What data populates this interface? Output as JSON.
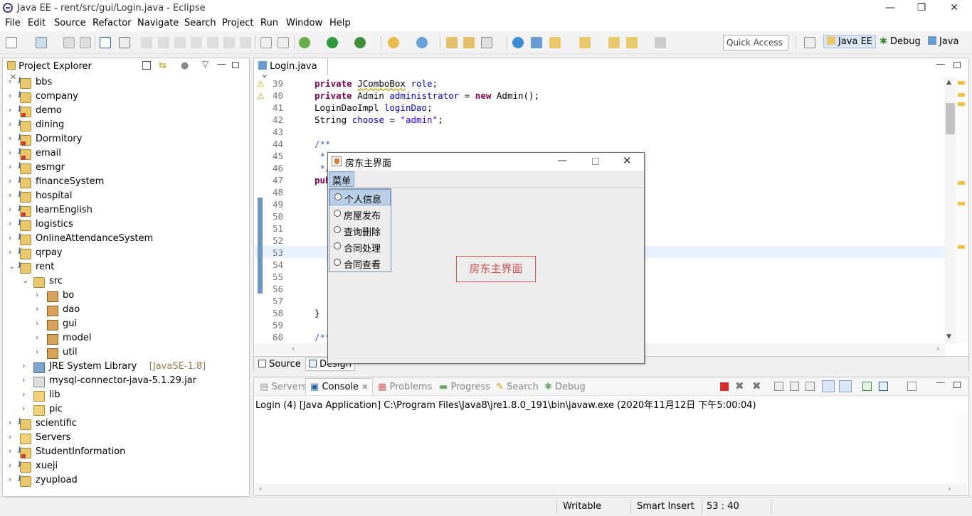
{
  "window": {
    "title": "Java EE - rent/src/gui/Login.java - Eclipse",
    "minimize": "—",
    "maximize": "❐",
    "close": "✕"
  },
  "menu": [
    "File",
    "Edit",
    "Source",
    "Refactor",
    "Navigate",
    "Search",
    "Project",
    "Run",
    "Window",
    "Help"
  ],
  "toolbar": {
    "quick_access_placeholder": "Quick Access"
  },
  "perspectives": [
    "Java EE",
    "Debug",
    "Java"
  ],
  "project_explorer": {
    "title": "Project Explorer",
    "items": [
      {
        "label": "bbs",
        "level": 0,
        "expanded": false,
        "icon": "project-icon"
      },
      {
        "label": "company",
        "level": 0,
        "expanded": false,
        "icon": "project-icon"
      },
      {
        "label": "demo",
        "level": 0,
        "expanded": false,
        "icon": "project-error-icon"
      },
      {
        "label": "dining",
        "level": 0,
        "expanded": false,
        "icon": "project-icon"
      },
      {
        "label": "Dormitory",
        "level": 0,
        "expanded": false,
        "icon": "project-error-icon"
      },
      {
        "label": "email",
        "level": 0,
        "expanded": false,
        "icon": "project-error-icon"
      },
      {
        "label": "esmgr",
        "level": 0,
        "expanded": false,
        "icon": "project-icon"
      },
      {
        "label": "financeSystem",
        "level": 0,
        "expanded": false,
        "icon": "project-icon"
      },
      {
        "label": "hospital",
        "level": 0,
        "expanded": false,
        "icon": "project-icon"
      },
      {
        "label": "learnEnglish",
        "level": 0,
        "expanded": false,
        "icon": "project-error-icon"
      },
      {
        "label": "logistics",
        "level": 0,
        "expanded": false,
        "icon": "project-icon"
      },
      {
        "label": "OnlineAttendanceSystem",
        "level": 0,
        "expanded": false,
        "icon": "project-icon"
      },
      {
        "label": "qrpay",
        "level": 0,
        "expanded": false,
        "icon": "project-icon"
      },
      {
        "label": "rent",
        "level": 0,
        "expanded": true,
        "icon": "project-icon"
      },
      {
        "label": "src",
        "level": 1,
        "expanded": true,
        "icon": "source-folder-icon"
      },
      {
        "label": "bo",
        "level": 2,
        "expanded": false,
        "icon": "package-icon"
      },
      {
        "label": "dao",
        "level": 2,
        "expanded": false,
        "icon": "package-icon"
      },
      {
        "label": "gui",
        "level": 2,
        "expanded": false,
        "icon": "package-icon"
      },
      {
        "label": "model",
        "level": 2,
        "expanded": false,
        "icon": "package-icon"
      },
      {
        "label": "util",
        "level": 2,
        "expanded": false,
        "icon": "package-icon"
      },
      {
        "label": "JRE System Library",
        "suffix": "[JavaSE-1.8]",
        "level": 1,
        "expanded": false,
        "icon": "library-icon"
      },
      {
        "label": "mysql-connector-java-5.1.29.jar",
        "level": 1,
        "expanded": false,
        "icon": "jar-icon"
      },
      {
        "label": "lib",
        "level": 1,
        "expanded": false,
        "icon": "folder-icon"
      },
      {
        "label": "pic",
        "level": 1,
        "expanded": false,
        "icon": "folder-icon"
      },
      {
        "label": "scientific",
        "level": 0,
        "expanded": false,
        "icon": "project-icon"
      },
      {
        "label": "Servers",
        "level": 0,
        "expanded": false,
        "icon": "folder-icon"
      },
      {
        "label": "StudentInformation",
        "level": 0,
        "expanded": false,
        "icon": "project-error-icon"
      },
      {
        "label": "xueji",
        "level": 0,
        "expanded": false,
        "icon": "project-icon"
      },
      {
        "label": "zyupload",
        "level": 0,
        "expanded": false,
        "icon": "project-icon"
      }
    ]
  },
  "editor": {
    "tab_label": "Login.java",
    "bottom_tabs": [
      "Source",
      "Design"
    ],
    "lines": [
      {
        "n": "39",
        "code": "private JComboBox role;"
      },
      {
        "n": "40",
        "code": "private Admin administrator = new Admin();"
      },
      {
        "n": "41",
        "code": "LoginDaoImpl loginDao;"
      },
      {
        "n": "42",
        "code": "String choose = \"admin\";"
      },
      {
        "n": "43",
        "code": ""
      },
      {
        "n": "44",
        "code": "/**"
      },
      {
        "n": "45",
        "code": " *"
      },
      {
        "n": "46",
        "code": " */"
      },
      {
        "n": "47",
        "code": "pub"
      },
      {
        "n": "48",
        "code": ""
      },
      {
        "n": "49",
        "code": ""
      },
      {
        "n": "50",
        "code": ""
      },
      {
        "n": "51",
        "code": ""
      },
      {
        "n": "52",
        "code": ""
      },
      {
        "n": "53",
        "code": ""
      },
      {
        "n": "54",
        "code": ""
      },
      {
        "n": "55",
        "code": ""
      },
      {
        "n": "56",
        "code": ""
      },
      {
        "n": "57",
        "code": ""
      },
      {
        "n": "58",
        "code": "}"
      },
      {
        "n": "59",
        "code": ""
      },
      {
        "n": "60",
        "code": "/**"
      }
    ]
  },
  "console": {
    "tabs": [
      "Servers",
      "Console",
      "Problems",
      "Progress",
      "Search",
      "Debug"
    ],
    "text": "Login (4) [Java Application] C:\\Program Files\\Java8\\jre1.8.0_191\\bin\\javaw.exe (2020年11月12日 下午5:00:04)"
  },
  "status": {
    "writable": "Writable",
    "insert_mode": "Smart Insert",
    "position": "53 : 40"
  },
  "swing_window": {
    "title": "房东主界面",
    "menu": "菜单",
    "items": [
      "个人信息",
      "房屋发布",
      "查询删除",
      "合同处理",
      "合同查看"
    ],
    "selected_index": 0,
    "center_label": "房东主界面"
  }
}
